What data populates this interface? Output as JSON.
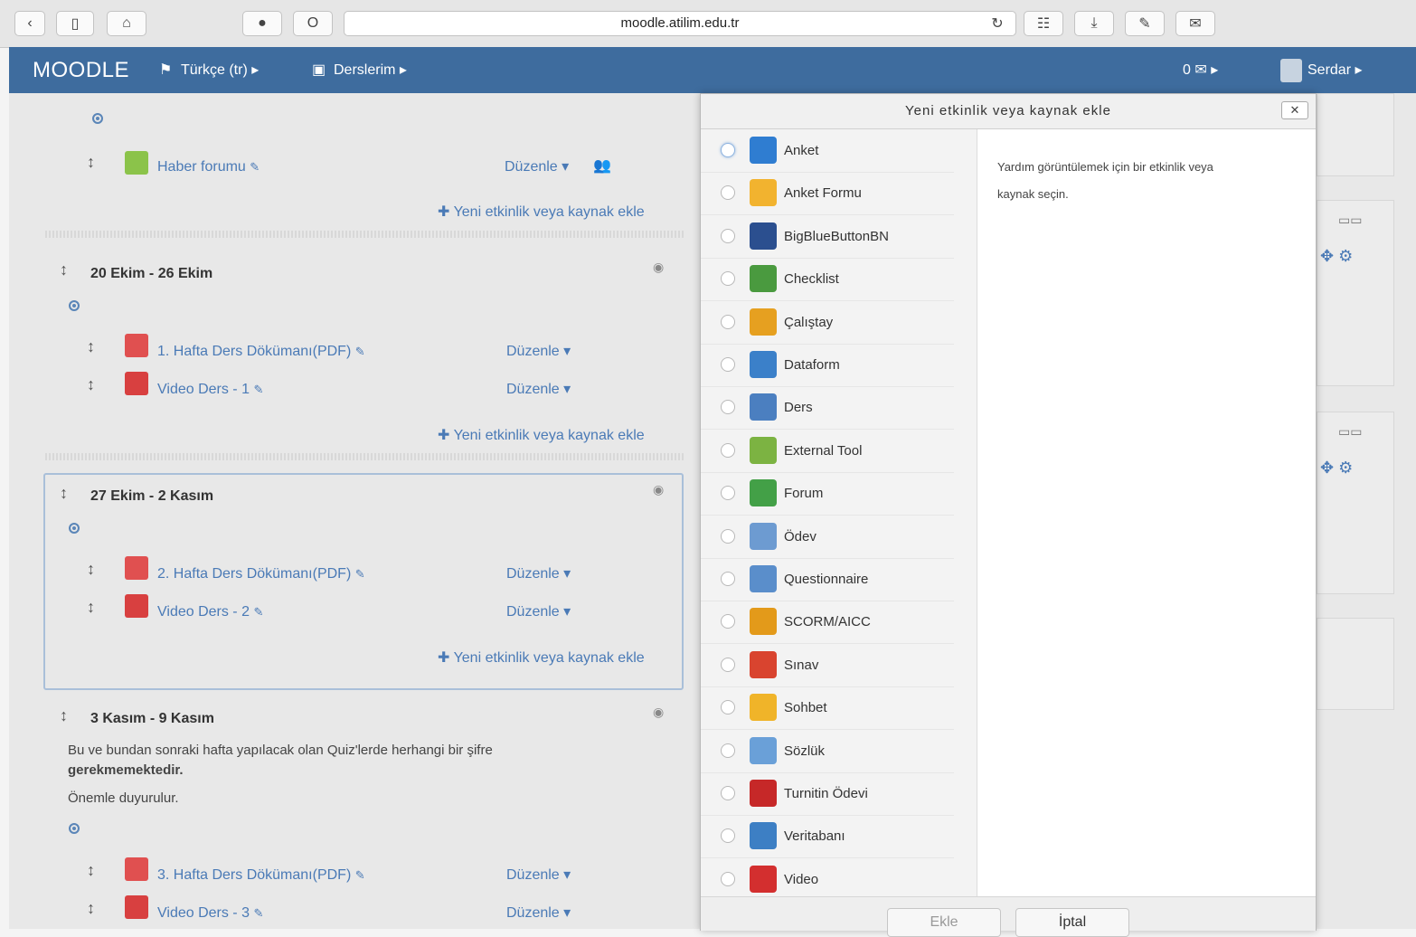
{
  "browser": {
    "url": "moodle.atilim.edu.tr"
  },
  "navbar": {
    "brand": "MOODLE",
    "language": "Türkçe (tr) ▸",
    "courses": "Derslerim ▸",
    "messages": "0 ✉  ▸",
    "user": "Serdar ▸",
    "color": "#3e6c9e"
  },
  "course": {
    "top_activity": {
      "title": "Haber forumu",
      "edit": "Düzenle ▾"
    },
    "add_activity": "✚ Yeni etkinlik veya kaynak ekle",
    "sections": [
      {
        "title": "20 Ekim - 26 Ekim",
        "activities": [
          {
            "title": "1. Hafta Ders Dökümanı(PDF)",
            "edit": "Düzenle ▾",
            "icon": "pdf-icon"
          },
          {
            "title": "Video Ders - 1",
            "edit": "Düzenle ▾",
            "icon": "flash-icon"
          }
        ]
      },
      {
        "title": "27 Ekim - 2 Kasım",
        "activities": [
          {
            "title": "2. Hafta Ders Dökümanı(PDF)",
            "edit": "Düzenle ▾",
            "icon": "pdf-icon"
          },
          {
            "title": "Video Ders - 2",
            "edit": "Düzenle ▾",
            "icon": "flash-icon"
          }
        ]
      },
      {
        "title": "3 Kasım - 9 Kasım",
        "summary_line1": "Bu ve bundan sonraki hafta yapılacak olan Quiz'lerde herhangi bir şifre",
        "summary_line1_bold": "gerekmemektedir.",
        "summary_line2": "Önemle duyurulur.",
        "activities": [
          {
            "title": "3. Hafta Ders Dökümanı(PDF)",
            "edit": "Düzenle ▾",
            "icon": "pdf-icon"
          },
          {
            "title": "Video Ders - 3",
            "edit": "Düzenle ▾",
            "icon": "flash-icon"
          }
        ]
      }
    ]
  },
  "modal": {
    "title": "Yeni etkinlik veya kaynak ekle",
    "close": "✕",
    "help_line1": "Yardım görüntülemek için bir etkinlik veya",
    "help_line2": "kaynak seçin.",
    "options": [
      {
        "label": "Anket",
        "icon": "question-icon"
      },
      {
        "label": "Anket Formu",
        "icon": "bar-chart-icon"
      },
      {
        "label": "BigBlueButtonBN",
        "icon": "bigbluebutton-icon"
      },
      {
        "label": "Checklist",
        "icon": "checklist-icon"
      },
      {
        "label": "Çalıştay",
        "icon": "workshop-icon"
      },
      {
        "label": "Dataform",
        "icon": "dataform-icon"
      },
      {
        "label": "Ders",
        "icon": "lesson-icon"
      },
      {
        "label": "External Tool",
        "icon": "puzzle-icon"
      },
      {
        "label": "Forum",
        "icon": "forum-icon"
      },
      {
        "label": "Ödev",
        "icon": "assignment-icon"
      },
      {
        "label": "Questionnaire",
        "icon": "questionnaire-icon"
      },
      {
        "label": "SCORM/AICC",
        "icon": "scorm-icon"
      },
      {
        "label": "Sınav",
        "icon": "quiz-icon"
      },
      {
        "label": "Sohbet",
        "icon": "chat-icon"
      },
      {
        "label": "Sözlük",
        "icon": "glossary-icon"
      },
      {
        "label": "Turnitin Ödevi",
        "icon": "turnitin-icon"
      },
      {
        "label": "Veritabanı",
        "icon": "database-icon"
      },
      {
        "label": "Video",
        "icon": "flash-icon"
      }
    ],
    "add_button": "Ekle",
    "cancel_button": "İptal"
  }
}
